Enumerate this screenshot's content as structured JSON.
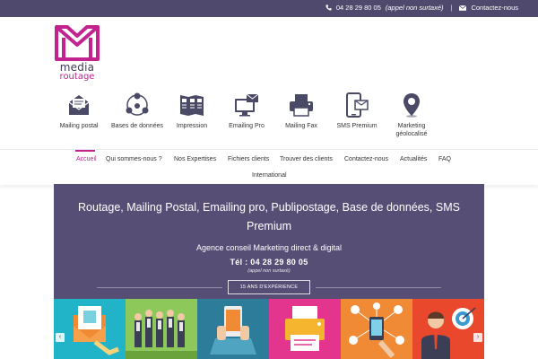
{
  "topbar": {
    "phone": "04 28 29 80 05",
    "phone_note": "(appel non surtaxé)",
    "separator": "|",
    "contact": "Contactez-nous"
  },
  "logo": {
    "line1": "media",
    "line2": "routage"
  },
  "services": [
    {
      "label": "Mailing postal",
      "icon": "envelope-icon"
    },
    {
      "label": "Bases de données",
      "icon": "network-icon"
    },
    {
      "label": "Impression",
      "icon": "brochure-icon"
    },
    {
      "label": "Emailing Pro",
      "icon": "monitor-mail-icon"
    },
    {
      "label": "Mailing Fax",
      "icon": "fax-icon"
    },
    {
      "label": "SMS Premium",
      "icon": "phone-sms-icon"
    },
    {
      "label": "Marketing géolocalisé",
      "icon": "map-pin-icon"
    }
  ],
  "nav": {
    "items": [
      "Accueil",
      "Qui sommes-nous ?",
      "Nos Expertises",
      "Fichiers clients",
      "Trouver des clients",
      "Contactez-nous",
      "Actualités",
      "FAQ",
      "International"
    ],
    "active": "Accueil"
  },
  "hero": {
    "title": "Routage, Mailing Postal, Emailing pro, Publipostage, Base de données, SMS Premium",
    "subtitle": "Agence conseil Marketing direct & digital",
    "tel": "Tél : 04 28 29 80 05",
    "tel_note": "(appel non surtaxé)",
    "button": "15 ANS D'EXPÉRIENCE"
  },
  "carousel": {
    "prev": "‹",
    "next": "›",
    "tiles": [
      "email-tile",
      "team-tile",
      "mobile-tile",
      "print-tile",
      "network-tile",
      "target-tile"
    ]
  },
  "colors": {
    "brand_purple": "#564e74",
    "topbar": "#4f4a6d",
    "accent_pink": "#c2238f"
  }
}
